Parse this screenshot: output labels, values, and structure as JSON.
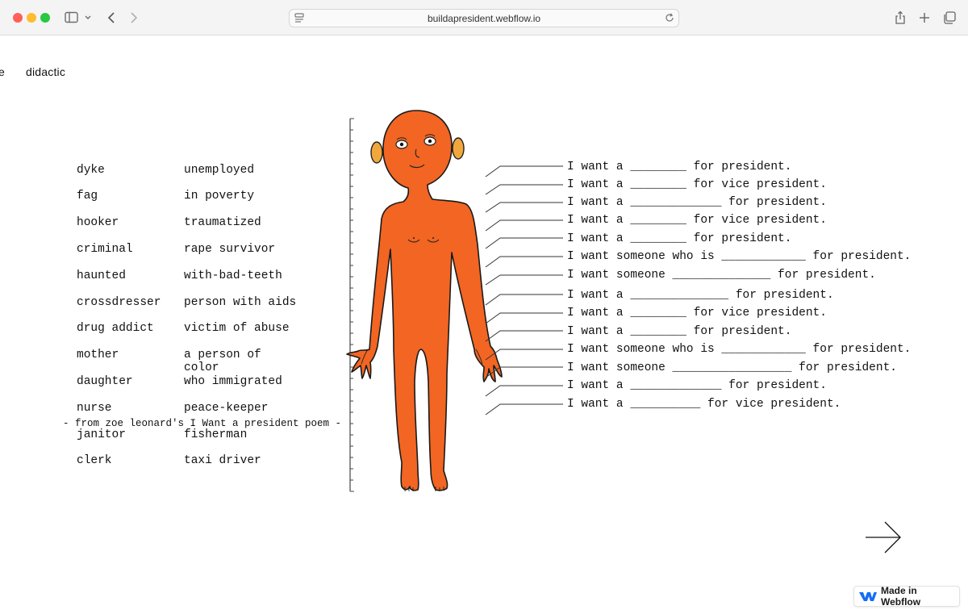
{
  "browser": {
    "url": "buildapresident.webflow.io"
  },
  "nav": {
    "fragment": "e",
    "didactic": "didactic"
  },
  "word_columns": {
    "left": [
      "dyke",
      "fag",
      "hooker",
      "criminal",
      "haunted",
      "crossdresser",
      "drug addict",
      "mother",
      "daughter",
      "nurse",
      "janitor",
      "clerk"
    ],
    "right": [
      "unemployed",
      "in poverty",
      "traumatized",
      "rape survivor",
      "with-bad-teeth",
      "person with aids",
      "victim of abuse",
      "a person of",
      "color",
      "who immigrated",
      "peace-keeper",
      "fisherman",
      "taxi driver"
    ]
  },
  "attribution": "- from zoe leonard's I Want a president poem -",
  "phrases": [
    "I want a ________ for president.",
    "I want a ________ for vice president.",
    "I want a _____________ for president.",
    "I want a ________ for vice president.",
    "I want a ________ for president.",
    "I want someone who is ____________ for president.",
    "I want someone ______________ for president.",
    "I want a ______________ for president.",
    "I want a ________ for vice president.",
    "I want a ________ for president.",
    "I want someone who is ____________ for president.",
    "I want someone _________________ for president.",
    "I want a _____________ for president.",
    "I want a __________ for vice president."
  ],
  "badge": {
    "label": "Made in Webflow"
  },
  "colors": {
    "figure_fill": "#f26522",
    "ear_fill": "#f0a83c",
    "badge_logo": "#146ef5"
  },
  "icons": {
    "next": "arrow-right-icon",
    "sidebar": "sidebar-icon",
    "back": "chevron-left-icon",
    "forward": "chevron-right-icon",
    "share": "share-icon",
    "new_tab": "plus-icon",
    "tabs": "tab-overview-icon",
    "reload": "reload-icon",
    "logo": "webflow-logo"
  }
}
